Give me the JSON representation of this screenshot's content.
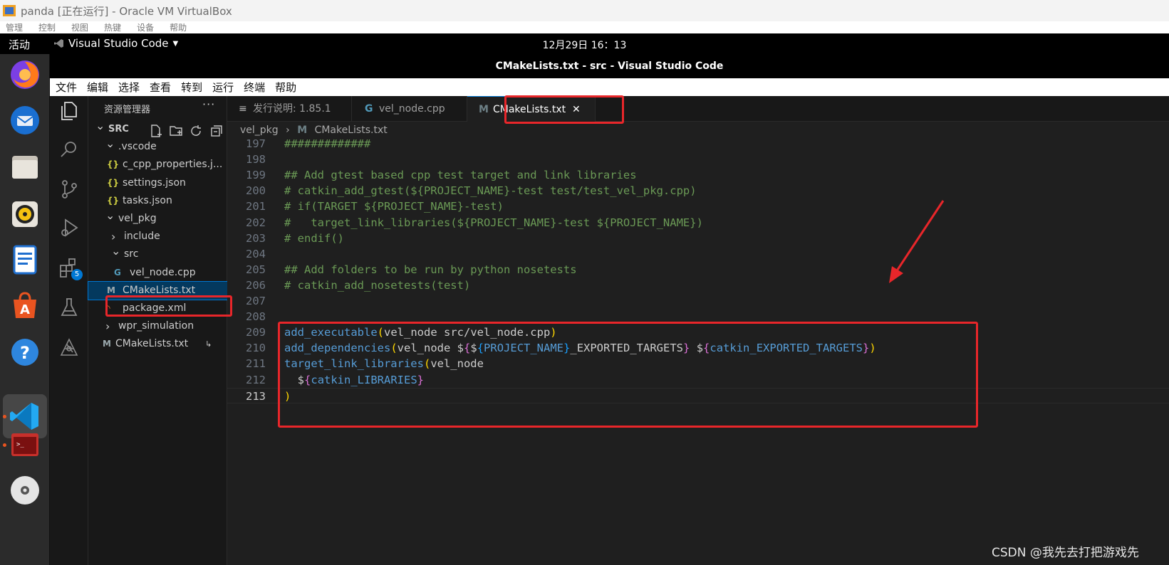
{
  "vbox": {
    "title": "panda [正在运行] - Oracle VM VirtualBox",
    "menu": [
      "管理",
      "控制",
      "视图",
      "热键",
      "设备",
      "帮助"
    ]
  },
  "ubuntu": {
    "activities": "活动",
    "app_name": "Visual Studio Code",
    "clock": "12月29日 16：13"
  },
  "window_title": "CMakeLists.txt - src - Visual Studio Code",
  "menubar": [
    "文件",
    "编辑",
    "选择",
    "查看",
    "转到",
    "运行",
    "终端",
    "帮助"
  ],
  "activity_badge": "5",
  "sidebar": {
    "header": "资源管理器",
    "more": "···",
    "tree": [
      {
        "label": "SRC",
        "depth": 0,
        "chevron": "v",
        "icon": ""
      },
      {
        "label": ".vscode",
        "depth": 1,
        "chevron": "v",
        "icon": ""
      },
      {
        "label": "c_cpp_properties.j...",
        "depth": 2,
        "chevron": "",
        "icon": "{}"
      },
      {
        "label": "settings.json",
        "depth": 2,
        "chevron": "",
        "icon": "{}"
      },
      {
        "label": "tasks.json",
        "depth": 2,
        "chevron": "",
        "icon": "{}"
      },
      {
        "label": "vel_pkg",
        "depth": 1,
        "chevron": "v",
        "icon": ""
      },
      {
        "label": "include",
        "depth": 2,
        "chevron": ">",
        "icon": ""
      },
      {
        "label": "src",
        "depth": 2,
        "chevron": "v",
        "icon": ""
      },
      {
        "label": "vel_node.cpp",
        "depth": 3,
        "chevron": "",
        "icon": "G"
      },
      {
        "label": "CMakeLists.txt",
        "depth": 2,
        "chevron": "",
        "icon": "M",
        "selected": true
      },
      {
        "label": "package.xml",
        "depth": 2,
        "chevron": "",
        "icon": "rss"
      },
      {
        "label": "wpr_simulation",
        "depth": 1,
        "chevron": ">",
        "icon": ""
      },
      {
        "label": "CMakeLists.txt",
        "depth": 1,
        "chevron": "",
        "icon": "M",
        "suffix": "↳"
      }
    ]
  },
  "tabs": [
    {
      "label": "发行说明: 1.85.1",
      "icon": "≡"
    },
    {
      "label": "vel_node.cpp",
      "icon": "G"
    },
    {
      "label": "CMakeLists.txt",
      "icon": "M",
      "active": true,
      "close": "✕"
    }
  ],
  "breadcrumb": {
    "folder": "vel_pkg",
    "sep": "›",
    "file": "CMakeLists.txt"
  },
  "code": [
    {
      "ln": "197",
      "tokens": [
        [
          "comment",
          "#############"
        ]
      ]
    },
    {
      "ln": "198",
      "tokens": []
    },
    {
      "ln": "199",
      "tokens": [
        [
          "comment",
          "## Add gtest based cpp test target and link libraries"
        ]
      ]
    },
    {
      "ln": "200",
      "tokens": [
        [
          "comment",
          "# catkin_add_gtest(${PROJECT_NAME}-test test/test_vel_pkg.cpp)"
        ]
      ]
    },
    {
      "ln": "201",
      "tokens": [
        [
          "comment",
          "# if(TARGET ${PROJECT_NAME}-test)"
        ]
      ]
    },
    {
      "ln": "202",
      "tokens": [
        [
          "comment",
          "#   target_link_libraries(${PROJECT_NAME}-test ${PROJECT_NAME})"
        ]
      ]
    },
    {
      "ln": "203",
      "tokens": [
        [
          "comment",
          "# endif()"
        ]
      ]
    },
    {
      "ln": "204",
      "tokens": []
    },
    {
      "ln": "205",
      "tokens": [
        [
          "comment",
          "## Add folders to be run by python nosetests"
        ]
      ]
    },
    {
      "ln": "206",
      "tokens": [
        [
          "comment",
          "# catkin_add_nosetests(test)"
        ]
      ]
    },
    {
      "ln": "207",
      "tokens": []
    },
    {
      "ln": "208",
      "tokens": []
    },
    {
      "ln": "209",
      "tokens": [
        [
          "fn",
          "add_executable"
        ],
        [
          "b1",
          "("
        ],
        [
          "plain",
          "vel_node src/vel_node.cpp"
        ],
        [
          "b1",
          ")"
        ]
      ]
    },
    {
      "ln": "210",
      "tokens": [
        [
          "fn",
          "add_dependencies"
        ],
        [
          "b1",
          "("
        ],
        [
          "plain",
          "vel_node "
        ],
        [
          "dollar",
          "$"
        ],
        [
          "b2",
          "{"
        ],
        [
          "dollar",
          "$"
        ],
        [
          "b3",
          "{"
        ],
        [
          "var",
          "PROJECT_NAME"
        ],
        [
          "b3",
          "}"
        ],
        [
          "plain",
          "_EXPORTED_TARGETS"
        ],
        [
          "b2",
          "}"
        ],
        [
          "plain",
          " "
        ],
        [
          "dollar",
          "$"
        ],
        [
          "b2",
          "{"
        ],
        [
          "var",
          "catkin_EXPORTED_TARGETS"
        ],
        [
          "b2",
          "}"
        ],
        [
          "b1",
          ")"
        ]
      ]
    },
    {
      "ln": "211",
      "tokens": [
        [
          "fn",
          "target_link_libraries"
        ],
        [
          "b1",
          "("
        ],
        [
          "plain",
          "vel_node"
        ]
      ]
    },
    {
      "ln": "212",
      "tokens": [
        [
          "plain",
          "  "
        ],
        [
          "dollar",
          "$"
        ],
        [
          "b2",
          "{"
        ],
        [
          "var",
          "catkin_LIBRARIES"
        ],
        [
          "b2",
          "}"
        ]
      ]
    },
    {
      "ln": "213",
      "tokens": [
        [
          "b1",
          ")"
        ]
      ],
      "current": true
    }
  ],
  "watermark": "CSDN @我先去打把游戏先",
  "colors": {
    "annotation_red": "#e8262a",
    "accent_blue": "#0078d4"
  }
}
